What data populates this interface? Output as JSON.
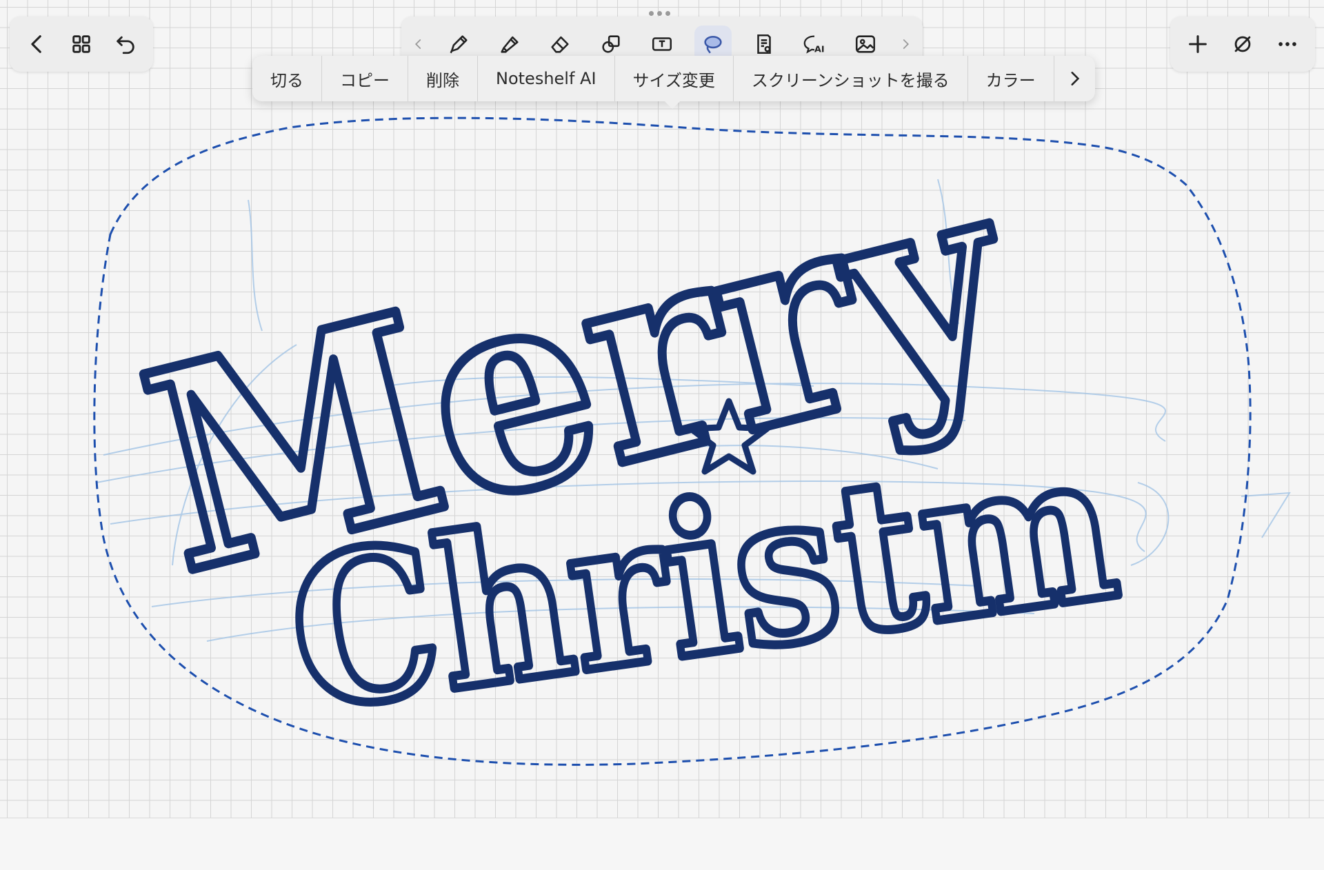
{
  "toolbar": {
    "left": [
      {
        "name": "back-button",
        "icon": "chevron-left-icon"
      },
      {
        "name": "pages-grid-button",
        "icon": "grid-icon"
      },
      {
        "name": "undo-button",
        "icon": "undo-icon"
      }
    ],
    "tools": [
      {
        "name": "scroll-left-button",
        "icon": "chevron-left-icon"
      },
      {
        "name": "pen-tool",
        "icon": "pen-icon"
      },
      {
        "name": "highlighter-tool",
        "icon": "highlighter-icon"
      },
      {
        "name": "eraser-tool",
        "icon": "eraser-icon"
      },
      {
        "name": "shape-tool",
        "icon": "shapes-icon"
      },
      {
        "name": "text-tool",
        "icon": "text-box-icon"
      },
      {
        "name": "lasso-tool",
        "icon": "lasso-icon",
        "active": true
      },
      {
        "name": "sticker-tool",
        "icon": "note-icon"
      },
      {
        "name": "ai-tool",
        "icon": "ai-chat-icon"
      },
      {
        "name": "image-tool",
        "icon": "image-icon"
      },
      {
        "name": "scroll-right-button",
        "icon": "chevron-right-icon"
      }
    ],
    "right": [
      {
        "name": "add-button",
        "icon": "plus-icon"
      },
      {
        "name": "pencil-only-button",
        "icon": "slash-circle-icon"
      },
      {
        "name": "more-button",
        "icon": "ellipsis-icon"
      }
    ]
  },
  "context_menu": {
    "items": [
      "切る",
      "コピー",
      "削除",
      "Noteshelf AI",
      "サイズ変更",
      "スクリーンショットを撮る",
      "カラー"
    ],
    "more_icon": "chevron-right-icon"
  },
  "canvas": {
    "handwriting_line1": "Merry",
    "handwriting_line2": "Christm",
    "ink_color": "#16306b",
    "sketch_color": "#9cc0e4",
    "lasso_color": "#1d4fae",
    "accent_active": "#dfe3ef"
  }
}
